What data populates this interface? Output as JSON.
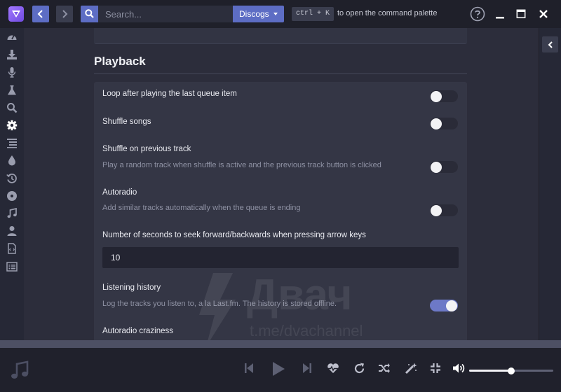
{
  "topbar": {
    "search": {
      "placeholder": "Search...",
      "value": ""
    },
    "source_select": "Discogs",
    "shortcut": "ctrl + K",
    "shortcut_hint": "to open the command palette",
    "icons": [
      "app-logo",
      "back-arrow",
      "forward-arrow",
      "search",
      "help",
      "minimize",
      "maximize",
      "close"
    ]
  },
  "sidebar": {
    "items": [
      {
        "icon": "dashboard",
        "active": false
      },
      {
        "icon": "download",
        "active": false
      },
      {
        "icon": "microphone",
        "active": false
      },
      {
        "icon": "flask",
        "active": false
      },
      {
        "icon": "search",
        "active": false
      },
      {
        "icon": "gear",
        "active": true
      },
      {
        "icon": "queue-list",
        "active": false
      },
      {
        "icon": "droplet",
        "active": false
      },
      {
        "icon": "history",
        "active": false
      },
      {
        "icon": "vinyl-disc",
        "active": false
      },
      {
        "icon": "music-note",
        "active": false
      },
      {
        "icon": "user",
        "active": false
      },
      {
        "icon": "file-code",
        "active": false
      },
      {
        "icon": "list-alt",
        "active": false
      }
    ]
  },
  "settings": {
    "section_title": "Playback",
    "items": [
      {
        "label": "Loop after playing the last queue item",
        "description": "",
        "enabled": false
      },
      {
        "label": "Shuffle songs",
        "description": "",
        "enabled": false
      },
      {
        "label": "Shuffle on previous track",
        "description": "Play a random track when shuffle is active and the previous track button is clicked",
        "enabled": false
      },
      {
        "label": "Autoradio",
        "description": "Add similar tracks automatically when the queue is ending",
        "enabled": false
      }
    ],
    "seek": {
      "label": "Number of seconds to seek forward/backwards when pressing arrow keys",
      "value": "10"
    },
    "history": {
      "label": "Listening history",
      "description": "Log the tracks you listen to, a la Last.fm. The history is stored offline.",
      "enabled": true
    },
    "cut_off_label": "Autoradio craziness"
  },
  "watermark": {
    "title": "Двач",
    "subtitle": "t.me/dvachannel"
  },
  "player": {
    "volume": 0.5,
    "controls": [
      "skip-back",
      "play",
      "skip-forward",
      "heart-pulse",
      "repeat",
      "shuffle",
      "magic-wand",
      "minimize",
      "volume-up"
    ]
  },
  "colors": {
    "accent": "#5d6dc4",
    "toggle_on": "#6d79c7",
    "background": "#2c2d3b"
  }
}
